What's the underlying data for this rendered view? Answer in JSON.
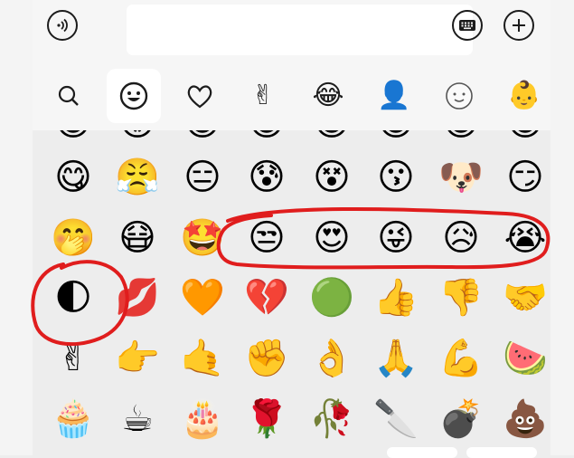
{
  "colors": {
    "annotation": "#e01d1d",
    "panel": "#ededed",
    "input_bg": "#ffffff"
  },
  "topbar": {
    "voice_icon": "voice-icon",
    "input_value": "",
    "keyboard_icon": "keyboard-icon",
    "add_icon": "plus-icon"
  },
  "tabs": [
    {
      "icon": "search-icon",
      "glyph": "🔍"
    },
    {
      "icon": "smiley-icon",
      "glyph": "☺"
    },
    {
      "icon": "heart-icon",
      "glyph": "♡"
    },
    {
      "icon": "gesture-icon",
      "glyph": "✌"
    },
    {
      "icon": "crying-laughing-icon",
      "glyph": "😂"
    },
    {
      "icon": "user-avatar-icon",
      "glyph": "👤"
    },
    {
      "icon": "face-outline-icon",
      "glyph": "☺"
    },
    {
      "icon": "baby-face-icon",
      "glyph": "👶"
    }
  ],
  "emoji_rows": [
    [
      "😋",
      "😤",
      "😑",
      "😰",
      "😵",
      "😗",
      "🐶",
      "😏"
    ],
    [
      "🤭",
      "😷",
      "🤩",
      "😒",
      "😍",
      "😜",
      "😥",
      "😭"
    ],
    [
      "🌓",
      "💋",
      "🧡",
      "💔",
      "🟢",
      "👍",
      "👎",
      "🤝"
    ],
    [
      "✌",
      "👉",
      "🤙",
      "✊",
      "👌",
      "🙏",
      "💪",
      "🍉"
    ],
    [
      "🧁",
      "☕",
      "🎂",
      "🌹",
      "🥀",
      "🔪",
      "💣",
      "💩"
    ]
  ],
  "partial_row": [
    "😁",
    "😡",
    "😁",
    "😁",
    "😁",
    "😁",
    "😁",
    "😁"
  ]
}
